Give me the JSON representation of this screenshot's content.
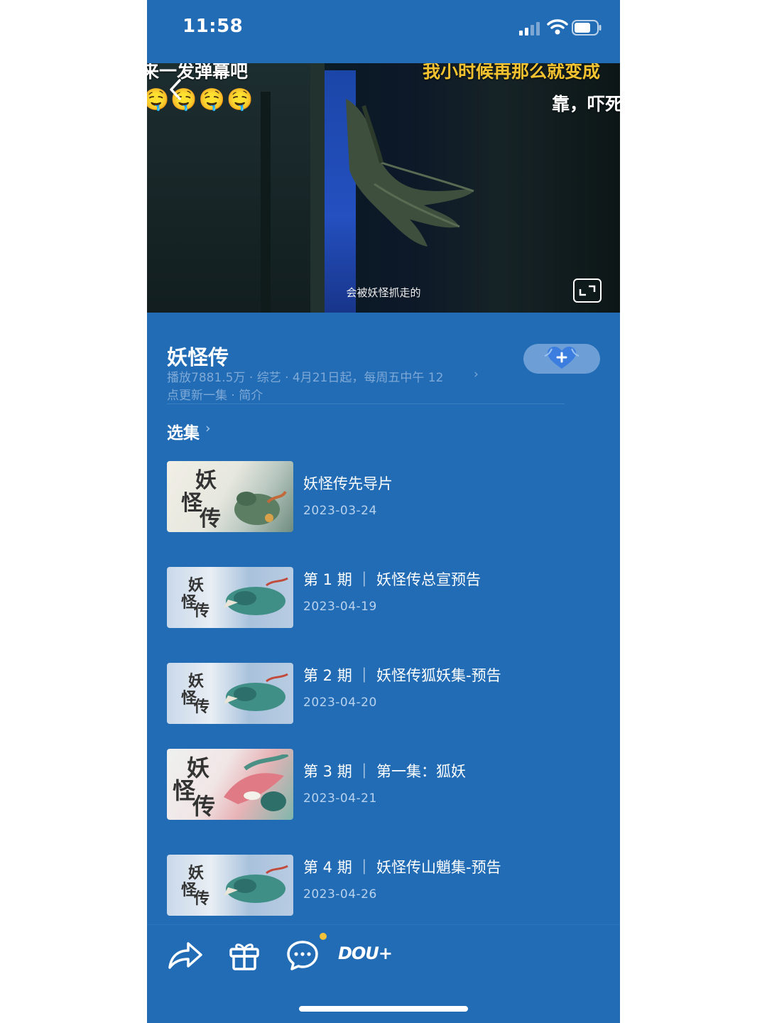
{
  "status_bar": {
    "time": "11:58"
  },
  "video": {
    "danmu": [
      "来一发弹幕吧",
      "我小时候再那么就变成",
      "靠，吓死"
    ],
    "emojis": "🤤🤤🤤🤤",
    "subtitle": "会被妖怪抓走的"
  },
  "show": {
    "title": "妖怪传",
    "meta_line1": "播放7881.5万 · 综艺 · 4月21日起，每周五中午 12",
    "meta_line2": "点更新一集 · 简介",
    "more_arrow": "›"
  },
  "episodes_section": {
    "label": "选集",
    "arrow": "›"
  },
  "episodes": [
    {
      "title": "妖怪传先导片",
      "date": "2023-03-24"
    },
    {
      "title": "第 1 期 ｜ 妖怪传总宣预告",
      "date": "2023-04-19"
    },
    {
      "title": "第 2 期 ｜ 妖怪传狐妖集-预告",
      "date": "2023-04-20"
    },
    {
      "title": "第 3 期 ｜ 第一集：狐妖",
      "date": "2023-04-21"
    },
    {
      "title": "第 4 期 ｜ 妖怪传山魈集-预告",
      "date": "2023-04-26"
    }
  ],
  "thumb_calligraphy": {
    "yao": "妖",
    "guai": "怪",
    "chuan": "传"
  },
  "bottom_bar": {
    "dou_label": "DOU+"
  },
  "icons": [
    "back-arrow-icon",
    "fullscreen-icon",
    "favorite-heart-icon",
    "share-icon",
    "gift-icon",
    "comment-icon",
    "signal-icon",
    "wifi-icon",
    "battery-icon"
  ],
  "colors": {
    "background": "#216cb5",
    "danmu_highlight": "#f2c230",
    "notification_dot": "#f3c23a"
  }
}
